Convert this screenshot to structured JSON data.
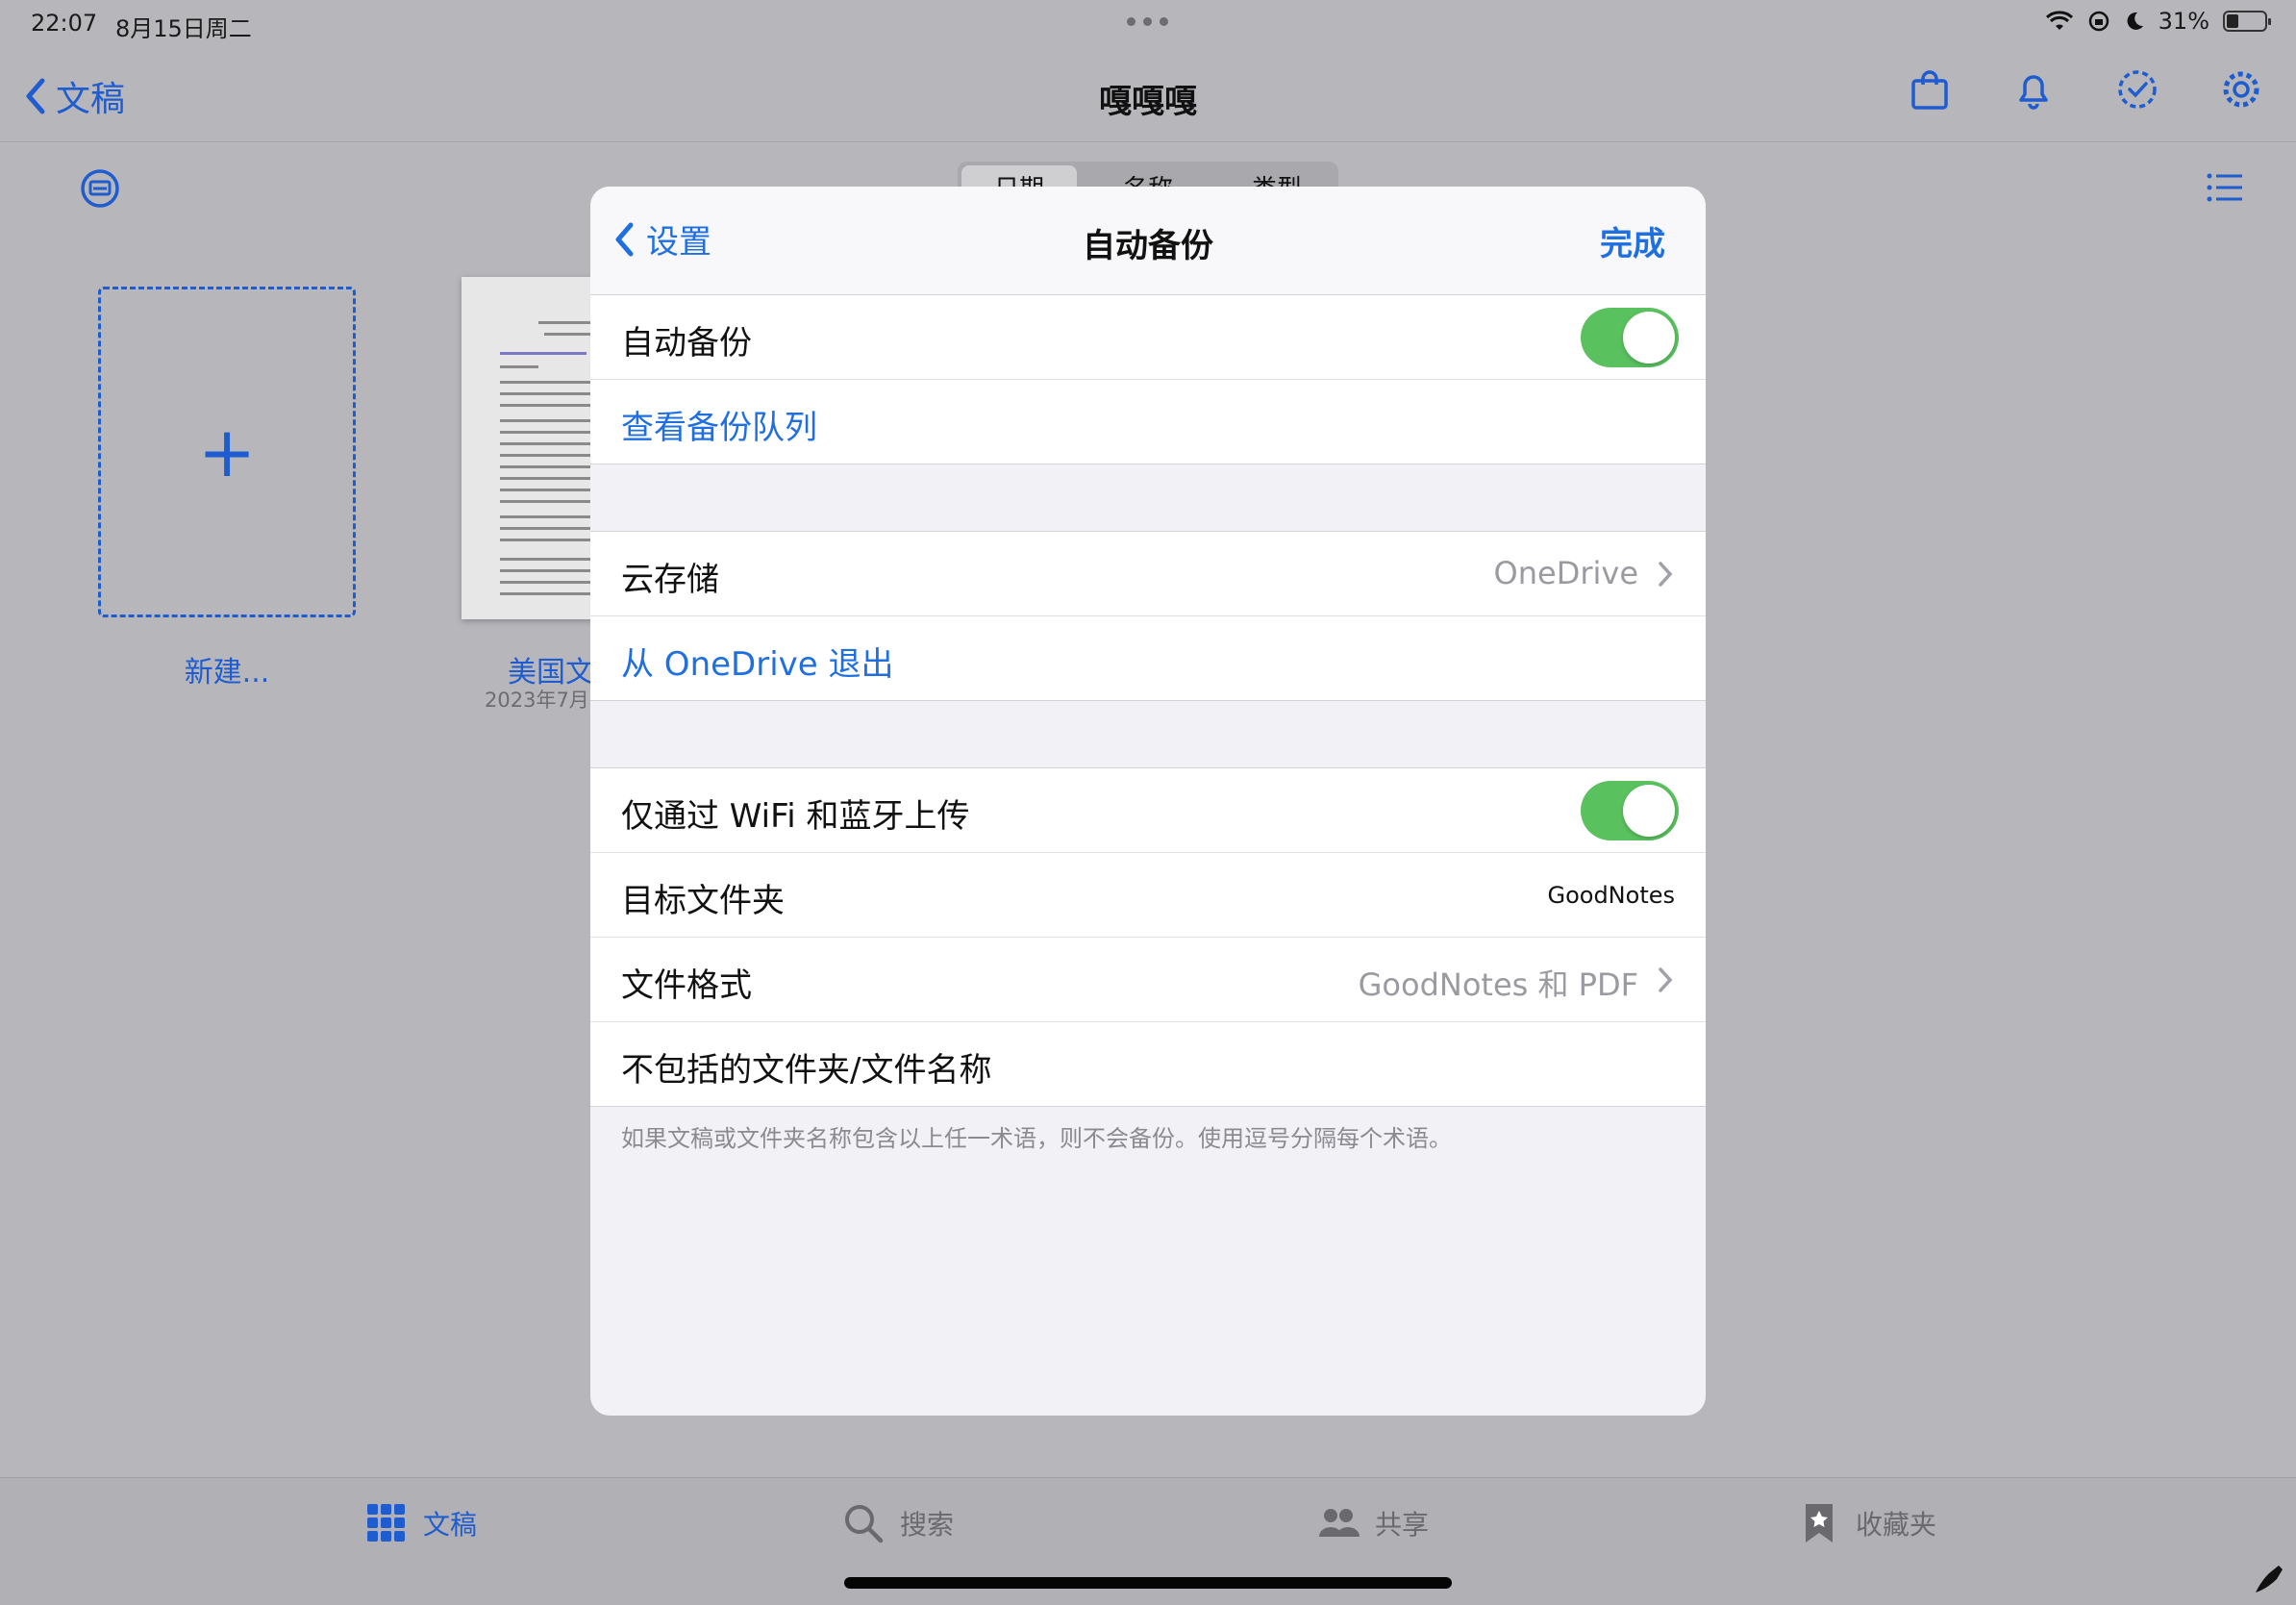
{
  "status_bar": {
    "time": "22:07",
    "date": "8月15日周二",
    "battery": "31%"
  },
  "nav": {
    "back_label": "文稿",
    "title": "嘎嘎嘎"
  },
  "segment": {
    "items": [
      "日期",
      "名称",
      "类型"
    ],
    "selected": "日期"
  },
  "library": {
    "new_label": "新建...",
    "doc_title": "美国文",
    "doc_date": "2023年7月"
  },
  "tabs": [
    {
      "label": "文稿",
      "icon": "grid-icon",
      "active": true
    },
    {
      "label": "搜索",
      "icon": "search-icon",
      "active": false
    },
    {
      "label": "共享",
      "icon": "people-icon",
      "active": false
    },
    {
      "label": "收藏夹",
      "icon": "bookmark-star-icon",
      "active": false
    }
  ],
  "modal": {
    "back_label": "设置",
    "title": "自动备份",
    "done_label": "完成",
    "auto_backup": {
      "label": "自动备份",
      "enabled": true
    },
    "view_queue": "查看备份队列",
    "cloud_storage": {
      "label": "云存储",
      "value": "OneDrive"
    },
    "sign_out": "从 OneDrive 退出",
    "wifi_only": {
      "label": "仅通过 WiFi 和蓝牙上传",
      "enabled": true
    },
    "target_folder": {
      "label": "目标文件夹",
      "value": "GoodNotes"
    },
    "file_format": {
      "label": "文件格式",
      "value": "GoodNotes 和 PDF"
    },
    "excluded": {
      "label": "不包括的文件夹/文件名称"
    },
    "footnote": "如果文稿或文件夹名称包含以上任一术语，则不会备份。使用逗号分隔每个术语。"
  },
  "colors": {
    "accent": "#1f6fe0",
    "toggle_on": "#5ac15f",
    "dim_background": "#b7b7bb"
  }
}
